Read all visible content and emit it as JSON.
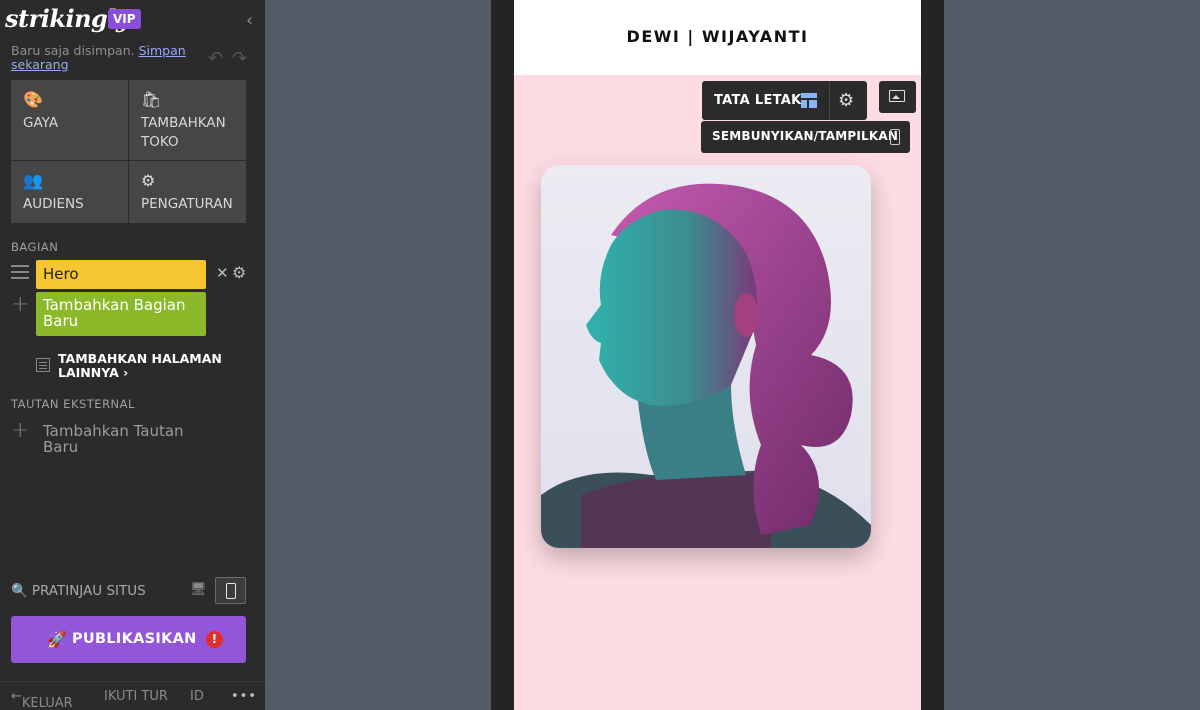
{
  "sidebar": {
    "logo": "strikingly",
    "vip": "VIP",
    "saved_text": "Baru saja disimpan.",
    "save_now": "Simpan sekarang",
    "tiles": [
      {
        "icon": "palette-icon",
        "label": "GAYA"
      },
      {
        "icon": "store-add-icon",
        "label": "TAMBAHKAN TOKO"
      },
      {
        "icon": "people-icon",
        "label": "AUDIENS"
      },
      {
        "icon": "gear-icon",
        "label": "PENGATURAN"
      }
    ],
    "sections_title": "BAGIAN",
    "sections": [
      {
        "label": "Hero"
      }
    ],
    "add_section": "Tambahkan Bagian Baru",
    "add_pages": "TAMBAHKAN HALAMAN LAINNYA ›",
    "external_title": "TAUTAN EKSTERNAL",
    "add_external": "Tambahkan Tautan Baru",
    "preview": "PRATINJAU SITUS",
    "publish": "PUBLIKASIKAN",
    "publish_warning": "!",
    "footer": {
      "exit": "KELUAR",
      "tour": "IKUTI TUR",
      "lang": "ID",
      "more": "•••"
    }
  },
  "site": {
    "title": "DEWI  |  WIJAYANTI"
  },
  "toolbar": {
    "layout": "TATA LETAK",
    "hide_show": "SEMBUNYIKAN/TAMPILKAN"
  },
  "colors": {
    "accent": "#9356d9",
    "hero_section": "#f5c62f",
    "add_section": "#8bb92a",
    "site_background": "#fddde3"
  }
}
